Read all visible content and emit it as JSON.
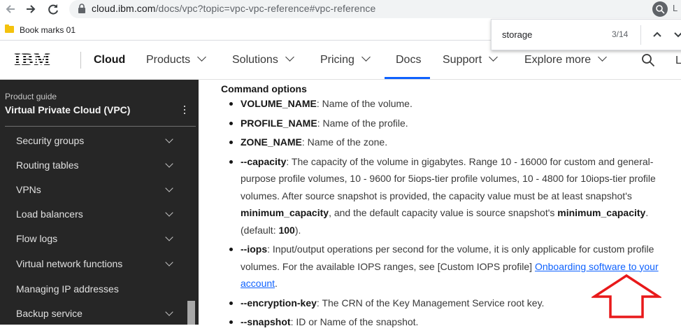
{
  "browser": {
    "url_host": "cloud.ibm.com",
    "url_rest": "/docs/vpc?topic=vpc-vpc-reference#vpc-reference",
    "url_tail": "L",
    "icons": [
      "back-arrow-icon",
      "forward-arrow-icon",
      "reload-icon",
      "lock-icon",
      "search-lens-icon"
    ]
  },
  "bookmarks": {
    "folder_label": "Book marks 01"
  },
  "find_bar": {
    "query": "storage",
    "count": "3/14"
  },
  "header": {
    "brand": "Cloud",
    "nav": [
      {
        "label": "Products"
      },
      {
        "label": "Solutions"
      },
      {
        "label": "Pricing"
      },
      {
        "label": "Docs"
      },
      {
        "label": "Support"
      },
      {
        "label": "Explore more"
      }
    ],
    "cut_text": "L",
    "accent": "#0f62fe"
  },
  "sidebar": {
    "label": "Product guide",
    "title": "Virtual Private Cloud (VPC)",
    "items": [
      {
        "label": "Security groups"
      },
      {
        "label": "Routing tables"
      },
      {
        "label": "VPNs"
      },
      {
        "label": "Load balancers"
      },
      {
        "label": "Flow logs"
      },
      {
        "label": "Virtual network functions"
      },
      {
        "label": "Managing IP addresses"
      },
      {
        "label": "Backup service"
      }
    ]
  },
  "content": {
    "heading": "Command options",
    "opts": [
      {
        "name": "VOLUME_NAME",
        "desc": ": Name of the volume."
      },
      {
        "name": "PROFILE_NAME",
        "desc": ": Name of the profile."
      },
      {
        "name": "ZONE_NAME",
        "desc": ": Name of the zone."
      },
      {
        "name": "--capacity",
        "desc1": ": The capacity of the volume in gigabytes. Range 10 - 16000 for custom and general-purpose profile volumes, 10 - 9600 for 5iops-tier profile volumes, 10 - 4800 for 10iops-tier profile volumes. After source snapshot is provided, the capacity value must be at least snapshot's ",
        "b1": "minimum_capacity",
        "desc2": ", and the default capacity value is source snapshot's ",
        "b2": "minimum_capacity",
        "desc3": ". (default: ",
        "b3": "100",
        "desc4": ")."
      },
      {
        "name": "--iops",
        "desc": ": Input/output operations per second for the volume, it is only applicable for custom profile volumes. For the available IOPS ranges, see [Custom IOPS profile] ",
        "link": "Onboarding software to your account",
        "after": "."
      },
      {
        "name": "--encryption-key",
        "desc": ": The CRN of the Key Management Service root key."
      },
      {
        "name": "--snapshot",
        "desc": ": ID or Name of the snapshot."
      }
    ]
  },
  "annotation": {
    "arrow_color": "#e8191a"
  }
}
